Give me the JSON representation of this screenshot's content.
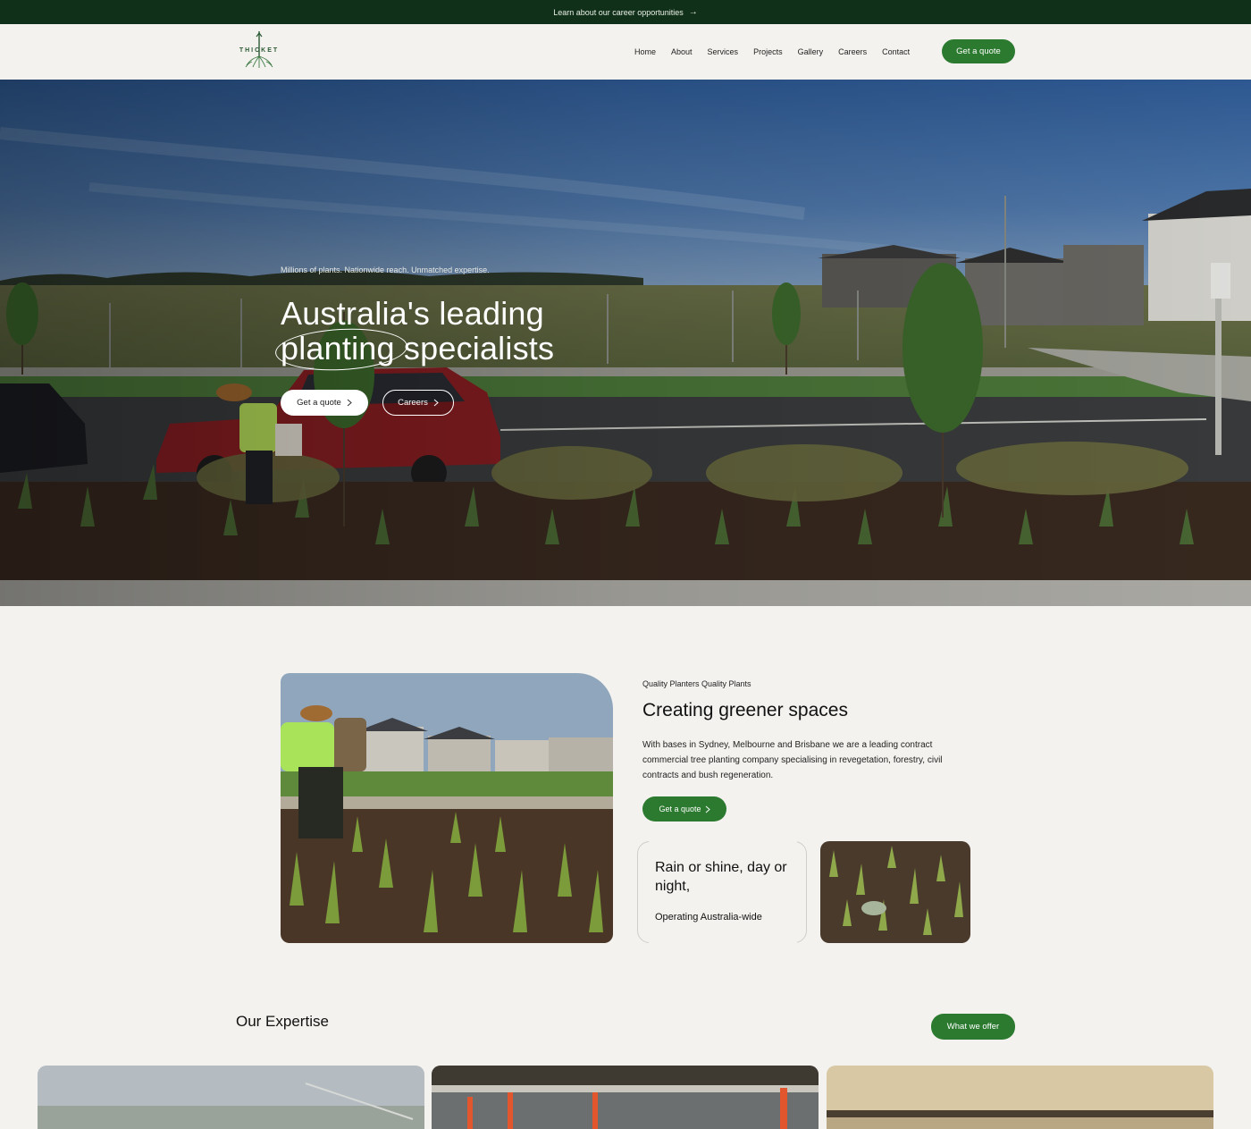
{
  "announcement": {
    "text": "Learn about our career opportunities",
    "arrow": "→"
  },
  "header": {
    "logo_text": "THICKET",
    "nav": [
      "Home",
      "About",
      "Services",
      "Projects",
      "Gallery",
      "Careers",
      "Contact"
    ],
    "cta": "Get a quote"
  },
  "hero": {
    "tagline": "Millions of plants. Nationwide reach. Unmatched expertise.",
    "title_line1": "Australia's leading",
    "title_circled": "planting",
    "title_line2_rest": " specialists",
    "primary_cta": "Get a quote",
    "secondary_cta": "Careers"
  },
  "about": {
    "eyebrow": "Quality Planters Quality Plants",
    "title": "Creating greener spaces",
    "text": "With bases in Sydney, Melbourne and Brisbane we are a leading contract commercial tree planting company specialising in revegetation, forestry, civil contracts and bush regeneration.",
    "cta": "Get a quote",
    "card_title": "Rain or shine, day or night,",
    "card_sub": "Operating Australia-wide"
  },
  "expertise": {
    "title": "Our Expertise",
    "cta": "What we offer"
  },
  "colors": {
    "brand_green": "#2b7a2f",
    "dark_green": "#11301a",
    "background": "#f3f2ee"
  },
  "icons": {
    "chevron": "chevron-right-icon",
    "arrow": "arrow-right-icon"
  }
}
